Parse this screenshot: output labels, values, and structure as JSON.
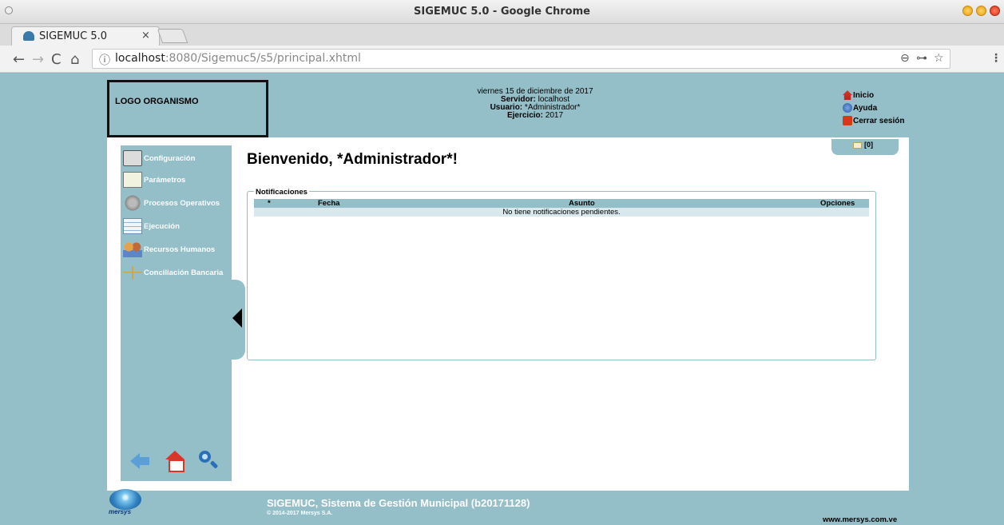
{
  "browser": {
    "window_title": "SIGEMUC 5.0 - Google Chrome",
    "tab_title": "SIGEMUC 5.0",
    "tab_close": "×",
    "url_host": "localhost",
    "url_rest": ":8080/Sigemuc5/s5/principal.xhtml",
    "info_icon": "ⓘ",
    "nav_back": "←",
    "nav_forward": "→",
    "nav_reload": "C",
    "nav_home": "⌂",
    "zoom_icon": "⊖",
    "key_icon": "⊶",
    "star_icon": "☆",
    "menu_icon": "⋮"
  },
  "header": {
    "logo_text": "LOGO ORGANISMO",
    "date": "viernes 15 de diciembre de 2017",
    "server_label": "Servidor:",
    "server_value": "localhost",
    "user_label": "Usuario:",
    "user_value": "*Administrador*",
    "year_label": "Ejercicio:",
    "year_value": "2017",
    "links": {
      "inicio": "Inicio",
      "ayuda": "Ayuda",
      "cerrar": "Cerrar sesión"
    },
    "notification_count": "[0]"
  },
  "sidebar": {
    "items": [
      {
        "label": "Configuración",
        "icon": "configuration-icon"
      },
      {
        "label": "Parámetros",
        "icon": "parameters-icon"
      },
      {
        "label": "Procesos Operativos",
        "icon": "gears-icon"
      },
      {
        "label": "Ejecución",
        "icon": "spreadsheet-icon"
      },
      {
        "label": "Recursos Humanos",
        "icon": "people-icon"
      },
      {
        "label": "Conciliación Bancaria",
        "icon": "scale-icon"
      }
    ]
  },
  "main": {
    "welcome": "Bienvenido, *Administrador*!",
    "notifications": {
      "legend": "Notificaciones",
      "columns": [
        "*",
        "Fecha",
        "Asunto",
        "Opciones"
      ],
      "empty_message": "No tiene notificaciones pendientes."
    }
  },
  "footer": {
    "logo_text": "mersys",
    "title": "SIGEMUC, Sistema de Gestión Municipal (b20171128)",
    "copyright": "© 2014-2017 Mersys S.A.",
    "url": "www.mersys.com.ve"
  }
}
